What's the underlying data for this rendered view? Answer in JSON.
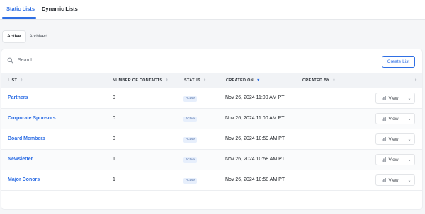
{
  "tabs": {
    "static": "Static Lists",
    "dynamic": "Dynamic Lists"
  },
  "subtabs": {
    "active": "Active",
    "archived": "Archived"
  },
  "toolbar": {
    "search_placeholder": "Search",
    "create_button": "Create List"
  },
  "table": {
    "headers": {
      "list": "LIST",
      "contacts": "NUMBER OF CONTACTS",
      "status": "STATUS",
      "created_on": "CREATED ON",
      "created_by": "CREATED BY"
    },
    "rows": [
      {
        "name": "Partners",
        "contacts": "0",
        "status": "Active",
        "created_on": "Nov 26, 2024 11:00 AM PT",
        "created_by": "",
        "action": "View"
      },
      {
        "name": "Corporate Sponsors",
        "contacts": "0",
        "status": "Active",
        "created_on": "Nov 26, 2024 11:00 AM PT",
        "created_by": "",
        "action": "View"
      },
      {
        "name": "Board Members",
        "contacts": "0",
        "status": "Active",
        "created_on": "Nov 26, 2024 10:59 AM PT",
        "created_by": "",
        "action": "View"
      },
      {
        "name": "Newsletter",
        "contacts": "1",
        "status": "Active",
        "created_on": "Nov 26, 2024 10:58 AM PT",
        "created_by": "",
        "action": "View"
      },
      {
        "name": "Major Donors",
        "contacts": "1",
        "status": "Active",
        "created_on": "Nov 26, 2024 10:58 AM PT",
        "created_by": "",
        "action": "View"
      }
    ]
  },
  "colors": {
    "accent": "#2f6fe4",
    "badge_bg": "#e7effc",
    "header_bg": "#f1f3f6"
  }
}
